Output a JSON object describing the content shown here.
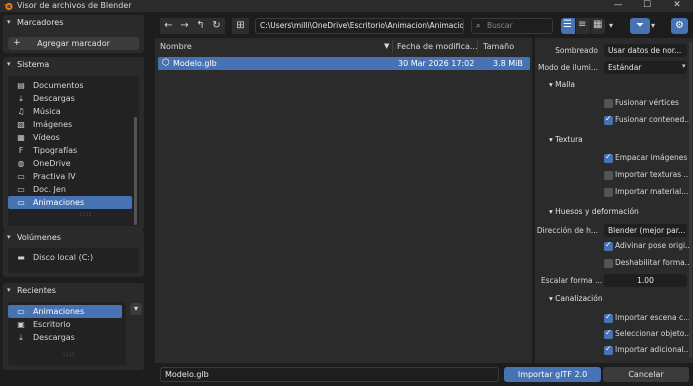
{
  "window": {
    "title": "Visor de archivos de Blender",
    "minimize": "—",
    "maximize": "☐",
    "close": "✕"
  },
  "sidebar": {
    "bookmarks": {
      "title": "Marcadores",
      "add_label": "Agregar marcador"
    },
    "system": {
      "title": "Sistema",
      "items": [
        {
          "label": "Documentos",
          "icon": "document-icon",
          "selected": false
        },
        {
          "label": "Descargas",
          "icon": "download-icon",
          "selected": false
        },
        {
          "label": "Música",
          "icon": "music-icon",
          "selected": false
        },
        {
          "label": "Imágenes",
          "icon": "image-icon",
          "selected": false
        },
        {
          "label": "Vídeos",
          "icon": "video-icon",
          "selected": false
        },
        {
          "label": "Tipografías",
          "icon": "font-icon",
          "selected": false
        },
        {
          "label": "OneDrive",
          "icon": "globe-icon",
          "selected": false
        },
        {
          "label": "Practiva IV",
          "icon": "folder-icon",
          "selected": false
        },
        {
          "label": "Doc. Jen",
          "icon": "folder-icon",
          "selected": false
        },
        {
          "label": "Animaciones",
          "icon": "folder-icon",
          "selected": true
        }
      ]
    },
    "volumes": {
      "title": "Volúmenes",
      "items": [
        {
          "label": "Disco local (C:)",
          "icon": "disk-icon"
        }
      ]
    },
    "recent": {
      "title": "Recientes",
      "items": [
        {
          "label": "Animaciones",
          "icon": "folder-icon",
          "selected": true
        },
        {
          "label": "Escritorio",
          "icon": "desktop-icon",
          "selected": false
        },
        {
          "label": "Descargas",
          "icon": "download-icon",
          "selected": false
        }
      ]
    }
  },
  "toolbar": {
    "path": "C:\\Users\\milli\\OneDrive\\Escritorio\\Animacion\\Animaciones\\",
    "search_placeholder": "Buscar"
  },
  "filelist": {
    "columns": {
      "name": "Nombre",
      "date": "Fecha de modifica...",
      "size": "Tamaño"
    },
    "rows": [
      {
        "name": "Modelo.glb",
        "date": "30 Mar 2026 17:02",
        "size": "3.8 MiB",
        "selected": true
      }
    ]
  },
  "options": {
    "shading": {
      "label": "Sombreado",
      "value": "Usar datos de nor..."
    },
    "lighting": {
      "label": "Modo de ilumi...",
      "value": "Estándar"
    },
    "mesh": {
      "title": "Malla",
      "checks": [
        {
          "label": "Fusionar vértices",
          "checked": false
        },
        {
          "label": "Fusionar contened...",
          "checked": true
        }
      ]
    },
    "texture": {
      "title": "Textura",
      "checks": [
        {
          "label": "Empacar imágenes",
          "checked": true
        },
        {
          "label": "Importar texturas ...",
          "checked": false
        },
        {
          "label": "Importar material...",
          "checked": false
        }
      ]
    },
    "bones": {
      "title": "Huesos y deformación",
      "direction_label": "Dirección de h...",
      "direction_value": "Blender (mejor par...",
      "checks": [
        {
          "label": "Adivinar pose origi...",
          "checked": true
        },
        {
          "label": "Deshabilitar forma...",
          "checked": false
        }
      ],
      "scale_label": "Escalar forma ...",
      "scale_value": "1.00"
    },
    "pipeline": {
      "title": "Canalización",
      "checks": [
        {
          "label": "Importar escena c...",
          "checked": true
        },
        {
          "label": "Seleccionar objeto...",
          "checked": true
        },
        {
          "label": "Importar adicional...",
          "checked": true
        }
      ]
    }
  },
  "footer": {
    "filename": "Modelo.glb",
    "import_label": "Importar glTF 2.0",
    "cancel_label": "Cancelar"
  },
  "colors": {
    "accent": "#4772b3",
    "background": "#1d1d1d",
    "panel": "#2b2b2b"
  }
}
